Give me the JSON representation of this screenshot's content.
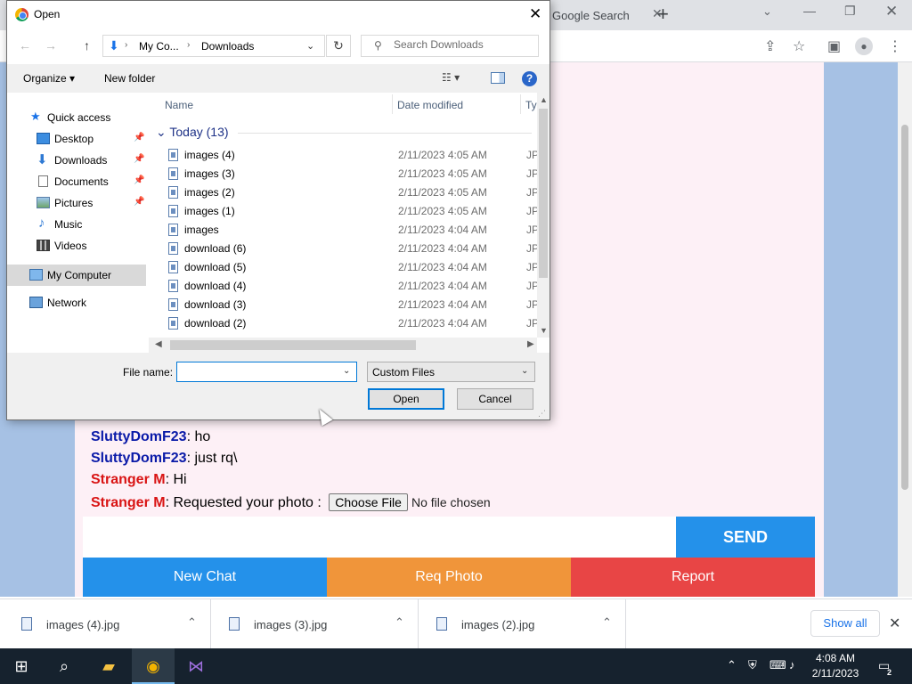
{
  "browser": {
    "tab_title": "Google Search",
    "tab_close": "✕",
    "new_tab": "+",
    "tab_search": "⌄",
    "window_min": "—",
    "window_max": "❐",
    "window_close": "✕"
  },
  "chat": {
    "messages": [
      {
        "sender": "SluttyDomF23",
        "text": ": ho",
        "color": "blue"
      },
      {
        "sender": "SluttyDomF23",
        "text": ": just rq\\",
        "color": "blue"
      },
      {
        "sender": "Stranger M",
        "text": ": Hi",
        "color": "red"
      },
      {
        "sender": "Stranger M",
        "text": ": Requested your photo : ",
        "color": "red"
      }
    ],
    "choose_file_label": "Choose File",
    "no_file_label": "No file chosen",
    "send_label": "SEND",
    "new_chat_label": "New Chat",
    "req_photo_label": "Req Photo",
    "report_label": "Report"
  },
  "dialog": {
    "title": "Open",
    "close_glyph": "✕",
    "address": {
      "root": "My Co...",
      "folder": "Downloads"
    },
    "search_placeholder": "Search Downloads",
    "organize_label": "Organize ▾",
    "new_folder_label": "New folder",
    "help_glyph": "?",
    "nav": [
      {
        "label": "Quick access",
        "pinned": false
      },
      {
        "label": "Desktop",
        "pinned": true
      },
      {
        "label": "Downloads",
        "pinned": true
      },
      {
        "label": "Documents",
        "pinned": true
      },
      {
        "label": "Pictures",
        "pinned": true
      },
      {
        "label": "Music",
        "pinned": false
      },
      {
        "label": "Videos",
        "pinned": false
      },
      {
        "label": "My Computer",
        "pinned": false,
        "selected": true
      },
      {
        "label": "Network",
        "pinned": false
      }
    ],
    "columns": {
      "name": "Name",
      "date": "Date modified",
      "type": "Ty"
    },
    "group_label": "Today (13)",
    "files": [
      {
        "name": "images (4)",
        "date": "2/11/2023 4:05 AM",
        "type": "JP"
      },
      {
        "name": "images (3)",
        "date": "2/11/2023 4:05 AM",
        "type": "JP"
      },
      {
        "name": "images (2)",
        "date": "2/11/2023 4:05 AM",
        "type": "JP"
      },
      {
        "name": "images (1)",
        "date": "2/11/2023 4:05 AM",
        "type": "JP"
      },
      {
        "name": "images",
        "date": "2/11/2023 4:04 AM",
        "type": "JP"
      },
      {
        "name": "download (6)",
        "date": "2/11/2023 4:04 AM",
        "type": "JP"
      },
      {
        "name": "download (5)",
        "date": "2/11/2023 4:04 AM",
        "type": "JP"
      },
      {
        "name": "download (4)",
        "date": "2/11/2023 4:04 AM",
        "type": "JP"
      },
      {
        "name": "download (3)",
        "date": "2/11/2023 4:04 AM",
        "type": "JP"
      },
      {
        "name": "download (2)",
        "date": "2/11/2023 4:04 AM",
        "type": "JP"
      }
    ],
    "file_name_label": "File name:",
    "file_name_value": "",
    "file_type_value": "Custom Files",
    "open_label": "Open",
    "cancel_label": "Cancel"
  },
  "downloads": {
    "items": [
      {
        "name": "images (4).jpg"
      },
      {
        "name": "images (3).jpg"
      },
      {
        "name": "images (2).jpg"
      }
    ],
    "show_all_label": "Show all",
    "close_glyph": "✕"
  },
  "taskbar": {
    "time": "4:08 AM",
    "date": "2/11/2023",
    "notification_count": "2"
  },
  "colors": {
    "blue_sender": "#0a1aa8",
    "red_sender": "#d91414",
    "send_blue": "#2491ea",
    "req_orange": "#f0953a",
    "report_red": "#e84545"
  }
}
